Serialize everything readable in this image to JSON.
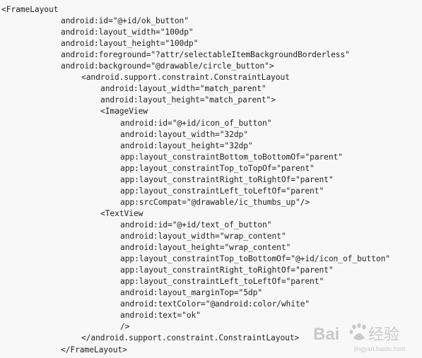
{
  "code": {
    "lines": [
      {
        "indent": 0,
        "text": "<FrameLayout"
      },
      {
        "indent": 1,
        "text": "android:id=\"@+id/ok_button\""
      },
      {
        "indent": 1,
        "text": "android:layout_width=\"100dp\""
      },
      {
        "indent": 1,
        "text": "android:layout_height=\"100dp\""
      },
      {
        "indent": 1,
        "text": "android:foreground=\"?attr/selectableItemBackgroundBorderless\""
      },
      {
        "indent": 1,
        "text": "android:background=\"@drawable/circle_button\">"
      },
      {
        "indent": 2,
        "text": "<android.support.constraint.ConstraintLayout"
      },
      {
        "indent": 3,
        "text": "android:layout_width=\"match_parent\""
      },
      {
        "indent": 3,
        "text": "android:layout_height=\"match_parent\">"
      },
      {
        "indent": 3,
        "text": "<ImageView"
      },
      {
        "indent": 4,
        "text": "android:id=\"@+id/icon_of_button\""
      },
      {
        "indent": 4,
        "text": "android:layout_width=\"32dp\""
      },
      {
        "indent": 4,
        "text": "android:layout_height=\"32dp\""
      },
      {
        "indent": 4,
        "text": "app:layout_constraintBottom_toBottomOf=\"parent\""
      },
      {
        "indent": 4,
        "text": "app:layout_constraintTop_toTopOf=\"parent\""
      },
      {
        "indent": 4,
        "text": "app:layout_constraintRight_toRightOf=\"parent\""
      },
      {
        "indent": 4,
        "text": "app:layout_constraintLeft_toLeftOf=\"parent\""
      },
      {
        "indent": 4,
        "text": "app:srcCompat=\"@drawable/ic_thumbs_up\"/>"
      },
      {
        "indent": 3,
        "text": "<TextView"
      },
      {
        "indent": 4,
        "text": "android:id=\"@+id/text_of_button\""
      },
      {
        "indent": 4,
        "text": "android:layout_width=\"wrap_content\""
      },
      {
        "indent": 4,
        "text": "android:layout_height=\"wrap_content\""
      },
      {
        "indent": 4,
        "text": "app:layout_constraintTop_toBottomOf=\"@+id/icon_of_button\""
      },
      {
        "indent": 4,
        "text": "app:layout_constraintRight_toRightOf=\"parent\""
      },
      {
        "indent": 4,
        "text": "app:layout_constraintLeft_toLeftOf=\"parent\""
      },
      {
        "indent": 4,
        "text": "android:layout_marginTop=\"5dp\""
      },
      {
        "indent": 4,
        "text": "android:textColor=\"@android:color/white\""
      },
      {
        "indent": 4,
        "text": "android:text=\"ok\""
      },
      {
        "indent": 4,
        "text": "/>"
      },
      {
        "indent": 2,
        "text": "</android.support.constraint.ConstraintLayout>"
      },
      {
        "indent": 1,
        "text": "</FrameLayout>"
      }
    ]
  },
  "watermark": {
    "logo_text_left": "Bai",
    "logo_text_right": "经验",
    "sub_text": "jingyan.baidu.com",
    "color": "#c9c9c9"
  },
  "colors": {
    "background": "#f8f8f8",
    "text": "#222222"
  }
}
